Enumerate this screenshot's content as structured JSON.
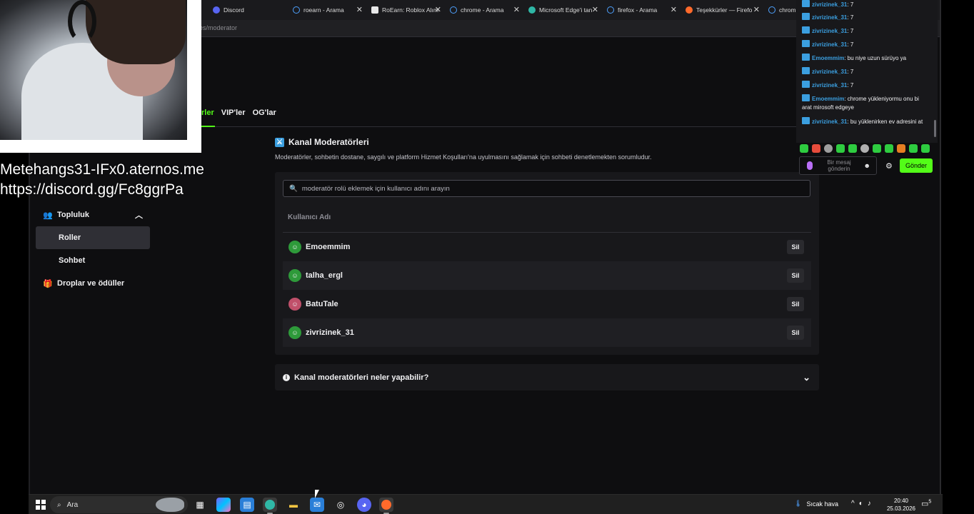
{
  "browser": {
    "tabs": [
      {
        "label": "Discord",
        "icon": "discord-icon",
        "color": "#5865f2"
      },
      {
        "label": "roearn - Arama",
        "icon": "search-icon",
        "color": "#4ea1ff"
      },
      {
        "label": "RoEarn: Roblox Alım",
        "icon": "site-icon",
        "color": "#e8e8e8"
      },
      {
        "label": "chrome - Arama",
        "icon": "search-icon",
        "color": "#4ea1ff"
      },
      {
        "label": "Microsoft Edge'i tan",
        "icon": "edge-icon",
        "color": "#2fb7a6"
      },
      {
        "label": "firefox - Arama",
        "icon": "search-icon",
        "color": "#4ea1ff"
      },
      {
        "label": "Teşekkürler — Firefo",
        "icon": "firefox-icon",
        "color": "#ff6a2b"
      },
      {
        "label": "chrome -",
        "icon": "search-icon",
        "color": "#4ea1ff"
      }
    ],
    "url": "oles/moderator"
  },
  "dashboard": {
    "tabs": [
      {
        "label": "rler",
        "active": true
      },
      {
        "label": "VIP'ler",
        "active": false
      },
      {
        "label": "OG'lar",
        "active": false
      }
    ],
    "section_title": "Kanal Moderatörleri",
    "section_desc": "Moderatörler, sohbetin dostane, saygılı ve platform Hizmet Koşulları'na uyulmasını sağlamak için sohbeti denetlemekten sorumludur.",
    "search_placeholder": "moderatör rolü eklemek için kullanıcı adını arayın",
    "col_header": "Kullanıcı Adı",
    "remove_label": "Sil",
    "moderators": [
      {
        "name": "Emoemmim",
        "avatar_color": "#2e9a3a"
      },
      {
        "name": "talha_ergl",
        "avatar_color": "#2e9a3a"
      },
      {
        "name": "BatuTale",
        "avatar_color": "#c0506a"
      },
      {
        "name": "zivrizinek_31",
        "avatar_color": "#2e9a3a"
      }
    ],
    "faq": "Kanal moderatörleri neler yapabilir?"
  },
  "sidebar": {
    "items": [
      {
        "label": "Topluluk",
        "icon": "community-icon"
      },
      {
        "label": "Roller"
      },
      {
        "label": "Sohbet"
      },
      {
        "label": "Droplar ve ödüller",
        "icon": "gift-icon"
      }
    ]
  },
  "overlay": {
    "line1": "Metehangs31-IFx0.aternos.me",
    "line2": "https://discord.gg/Fc8ggrPa"
  },
  "chat": {
    "messages": [
      {
        "user": "zivrizinek_31",
        "text": ": 7"
      },
      {
        "user": "zivrizinek_31",
        "text": ": 7"
      },
      {
        "user": "zivrizinek_31",
        "text": ": 7"
      },
      {
        "user": "zivrizinek_31",
        "text": ": 7"
      },
      {
        "user": "Emoemmim",
        "text": ": bu niye uzun sürüyo ya"
      },
      {
        "user": "zivrizinek_31",
        "text": ": 7"
      },
      {
        "user": "zivrizinek_31",
        "text": ": 7"
      },
      {
        "user": "Emoemmim",
        "text": ": chrome yükleniyormu onu bi arat mirosoft edgeye"
      },
      {
        "user": "zivrizinek_31",
        "text": ": bu yüklenirken ev adresini at"
      }
    ],
    "input_placeholder": "Bir mesaj gönderin",
    "send_label": "Gönder",
    "accent": "#53fc18"
  },
  "taskbar": {
    "search_label": "Ara",
    "weather": "Sıcak hava",
    "time": "20:40",
    "date": "25.03.2026",
    "notification_count": "5"
  }
}
